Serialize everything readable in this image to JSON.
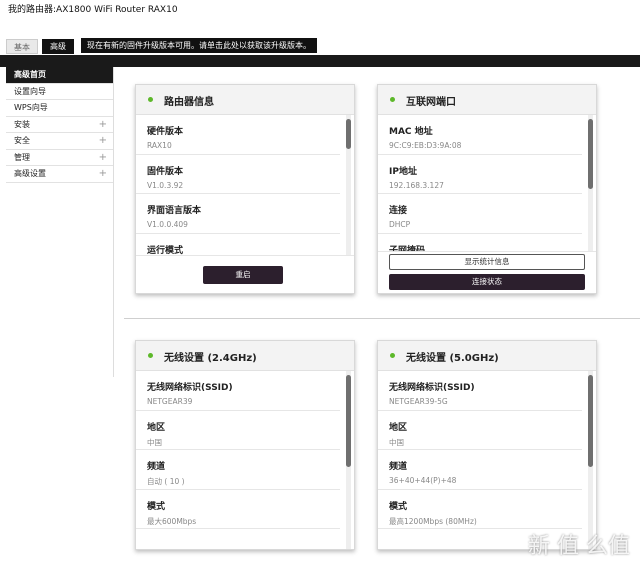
{
  "router_title": "我的路由器:AX1800 WiFi Router RAX10",
  "tabs": {
    "basic": "基本",
    "advanced": "高级"
  },
  "notice": "现在有新的固件升级版本可用。请单击此处以获取该升级版本。",
  "sidebar": {
    "items": [
      {
        "label": "高级首页",
        "active": true,
        "expandable": false
      },
      {
        "label": "设置向导",
        "active": false,
        "expandable": false
      },
      {
        "label": "WPS向导",
        "active": false,
        "expandable": false
      },
      {
        "label": "安装",
        "active": false,
        "expandable": true
      },
      {
        "label": "安全",
        "active": false,
        "expandable": true
      },
      {
        "label": "管理",
        "active": false,
        "expandable": true
      },
      {
        "label": "高级设置",
        "active": false,
        "expandable": true
      }
    ],
    "plus_icon": "+"
  },
  "cards": {
    "router_info": {
      "title": "路由器信息",
      "fields": [
        {
          "label": "硬件版本",
          "value": "RAX10"
        },
        {
          "label": "固件版本",
          "value": "V1.0.3.92"
        },
        {
          "label": "界面语言版本",
          "value": "V1.0.0.409"
        },
        {
          "label": "运行模式",
          "value": ""
        }
      ],
      "reboot_button": "重启"
    },
    "internet_port": {
      "title": "互联网端口",
      "fields": [
        {
          "label": "MAC 地址",
          "value": "9C:C9:EB:D3:9A:08"
        },
        {
          "label": "IP地址",
          "value": "192.168.3.127"
        },
        {
          "label": "连接",
          "value": "DHCP"
        },
        {
          "label": "子网掩码",
          "value": ""
        }
      ],
      "stats_button": "显示统计信息",
      "status_button": "连接状态"
    },
    "wireless_24": {
      "title": "无线设置 (2.4GHz)",
      "fields": [
        {
          "label": "无线网络标识(SSID)",
          "value": "NETGEAR39"
        },
        {
          "label": "地区",
          "value": "中国"
        },
        {
          "label": "频道",
          "value": "自动 ( 10 )"
        },
        {
          "label": "模式",
          "value": "最大600Mbps"
        }
      ]
    },
    "wireless_50": {
      "title": "无线设置 (5.0GHz)",
      "fields": [
        {
          "label": "无线网络标识(SSID)",
          "value": "NETGEAR39-5G"
        },
        {
          "label": "地区",
          "value": "中国"
        },
        {
          "label": "频道",
          "value": "36+40+44(P)+48"
        },
        {
          "label": "模式",
          "value": "最高1200Mbps (80MHz)"
        }
      ]
    }
  },
  "watermark": "新 值 么值",
  "colors": {
    "status_dot": "#5db82a",
    "dark": "#1a1a1a",
    "button_dark": "#2c1f2d"
  }
}
